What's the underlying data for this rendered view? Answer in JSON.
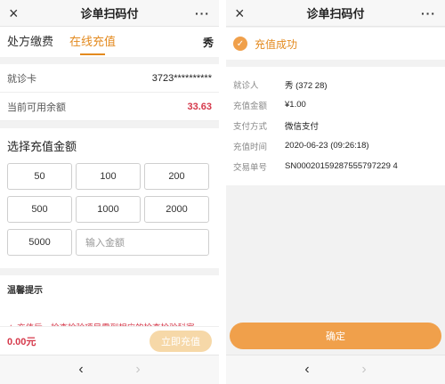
{
  "left": {
    "header": {
      "title": "诊单扫码付",
      "close_icon": "×",
      "more_icon": "···"
    },
    "tabs": [
      {
        "label": "处方缴费"
      },
      {
        "label": "在线充值"
      }
    ],
    "tab_edge_text": "秀",
    "info": {
      "card_label": "就诊卡",
      "card_value": "3723**********",
      "balance_label": "当前可用余额",
      "balance_value": "33.63"
    },
    "amounts": {
      "title": "选择充值金额",
      "options": [
        "50",
        "100",
        "200",
        "500",
        "1000",
        "2000",
        "5000"
      ],
      "input_placeholder": "输入金额"
    },
    "tips": {
      "title": "温馨提示",
      "text": "★ 充值后，检查检验项目需到相应的检查检验科室"
    },
    "bottom": {
      "total": "0.00元",
      "pay_label": "立即充值"
    },
    "nav": {
      "back": "‹",
      "forward": "›"
    }
  },
  "right": {
    "header": {
      "title": "诊单扫码付",
      "close_icon": "×",
      "more_icon": "···"
    },
    "success": {
      "icon": "✓",
      "text": "充值成功"
    },
    "details": [
      {
        "label": "就诊人",
        "value": "秀 (372                    28)"
      },
      {
        "label": "充值金额",
        "value": "¥1.00"
      },
      {
        "label": "支付方式",
        "value": "微信支付"
      },
      {
        "label": "充值时间",
        "value": "2020-06-23 (09:26:18)"
      },
      {
        "label": "交易单号",
        "value": "SN00020159287555797229 4"
      }
    ],
    "confirm_label": "确定",
    "nav": {
      "back": "‹",
      "forward": "›"
    }
  },
  "colors": {
    "accent": "#e38a1f",
    "button_orange": "#f0a04b",
    "red": "#d5384a"
  }
}
